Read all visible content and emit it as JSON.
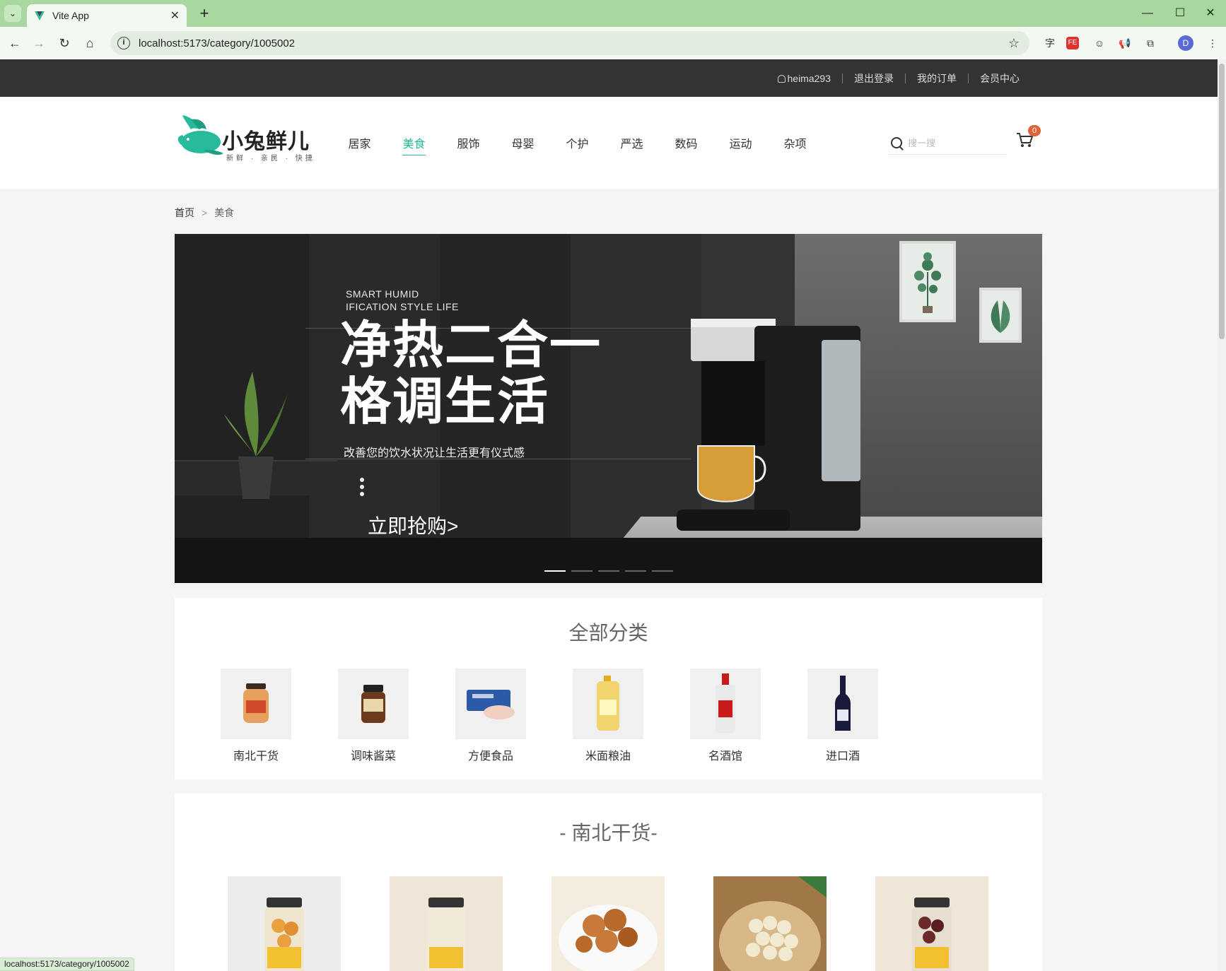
{
  "browser": {
    "tab_title": "Vite App",
    "url": "localhost:5173/category/1005002",
    "status_url": "localhost:5173/category/1005002",
    "profile_initial": "D",
    "ext_translate": "字"
  },
  "topnav": {
    "username": "heima293",
    "logout": "退出登录",
    "orders": "我的订单",
    "member": "会员中心"
  },
  "header": {
    "logo_text": "小兔鲜儿",
    "logo_sub": "新鲜 · 亲民 · 快捷",
    "nav": [
      "居家",
      "美食",
      "服饰",
      "母婴",
      "个护",
      "严选",
      "数码",
      "运动",
      "杂项"
    ],
    "active_nav": "美食",
    "search_placeholder": "搜一搜",
    "cart_count": "0"
  },
  "breadcrumb": {
    "home": "首页",
    "separator": ">",
    "current": "美食"
  },
  "banner": {
    "tagline_line1": "SMART HUMID",
    "tagline_line2": "IFICATION STYLE LIFE",
    "headline_line1": "净热二合一",
    "headline_line2": "格调生活",
    "subline": "改善您的饮水状况让生活更有仪式感",
    "cta": "立即抢购>",
    "slide_count": 5,
    "active_slide": 1
  },
  "all_categories": {
    "title": "全部分类",
    "items": [
      {
        "name": "南北干货",
        "icon": "dried-goods-jar-icon"
      },
      {
        "name": "调味酱菜",
        "icon": "sauce-jar-icon"
      },
      {
        "name": "方便食品",
        "icon": "canned-meat-icon"
      },
      {
        "name": "米面粮油",
        "icon": "oil-bottle-icon"
      },
      {
        "name": "名酒馆",
        "icon": "liquor-bottle-icon"
      },
      {
        "name": "进口酒",
        "icon": "wine-bottle-icon"
      }
    ]
  },
  "subsection": {
    "title": "- 南北干货-",
    "goods_count": 5
  },
  "colors": {
    "brand": "#27ba9b",
    "topbar": "#333333",
    "badge": "#e26237",
    "browser_frame": "#a8d8a0"
  }
}
